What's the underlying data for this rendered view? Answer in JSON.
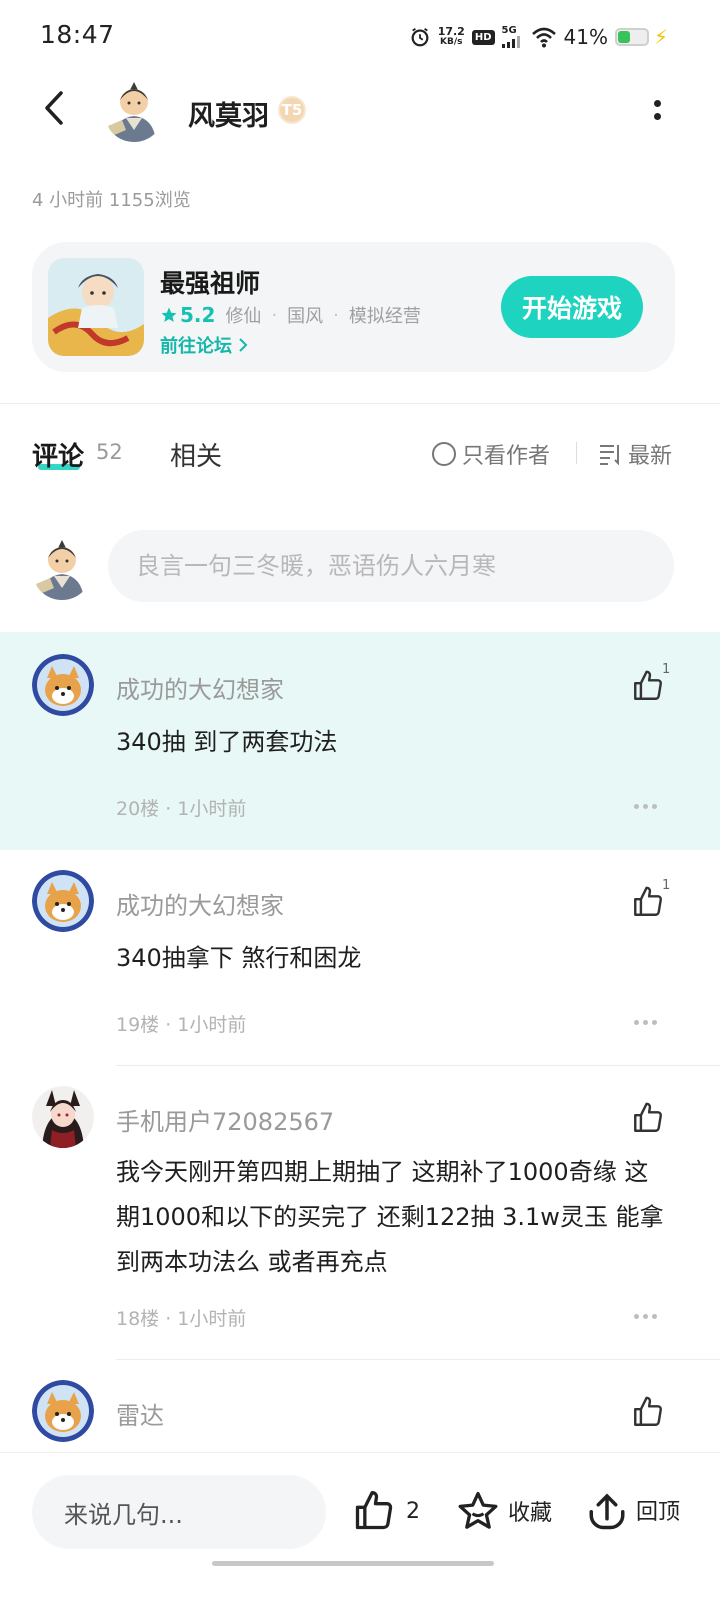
{
  "status_bar": {
    "time": "18:47",
    "net_speed_value": "17.2",
    "net_speed_unit": "KB/s",
    "hd_label": "HD",
    "network_label": "5G",
    "battery_percent": "41%",
    "battery_level": 0.41,
    "battery_color": "#36c35a"
  },
  "header": {
    "author_name": "风莫羽",
    "level_badge": "T5",
    "back_icon": "chevron-left-icon",
    "more_icon": "more-vertical-icon"
  },
  "post": {
    "meta": "4 小时前  1155浏览"
  },
  "game_card": {
    "title": "最强祖师",
    "rating": "5.2",
    "tags": [
      "修仙",
      "国风",
      "模拟经营"
    ],
    "forum_link": "前往论坛",
    "play_button": "开始游戏",
    "accent_color": "#1ed3c0"
  },
  "tabs": {
    "comments_label": "评论",
    "comments_count": "52",
    "related_label": "相关",
    "author_only_label": "只看作者",
    "sort_label": "最新"
  },
  "comment_input": {
    "placeholder": "良言一句三冬暖，恶语伤人六月寒"
  },
  "comments": [
    {
      "user": "成功的大幻想家",
      "body": "340抽 到了两套功法",
      "meta": "20楼 · 1小时前",
      "likes": "1",
      "highlight": true
    },
    {
      "user": "成功的大幻想家",
      "body": "340抽拿下 煞行和困龙",
      "meta": "19楼 · 1小时前",
      "likes": "1",
      "highlight": false
    },
    {
      "user": "手机用户72082567",
      "body": "我今天刚开第四期上期抽了 这期补了1000奇缘 这期1000和以下的买完了 还剩122抽 3.1w灵玉 能拿到两本功法么 或者再充点",
      "meta": "18楼 · 1小时前",
      "likes": "",
      "highlight": false
    },
    {
      "user": "雷达",
      "body": "",
      "meta": "",
      "likes": "",
      "highlight": false
    }
  ],
  "bottom_bar": {
    "reply_placeholder": "来说几句...",
    "like_count": "2",
    "favorite_label": "收藏",
    "top_label": "回顶"
  }
}
